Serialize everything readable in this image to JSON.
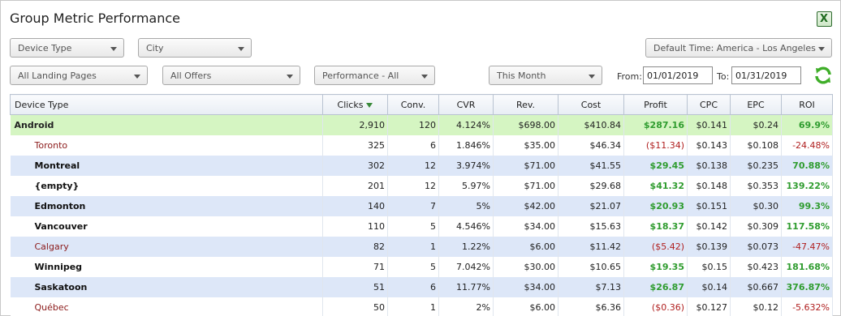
{
  "title": "Group Metric Performance",
  "filters": {
    "device_type": "Device Type",
    "city": "City",
    "time_zone": "Default Time: America - Los Angeles",
    "landing_pages": "All Landing Pages",
    "offers": "All Offers",
    "performance": "Performance - All",
    "date_range": "This Month",
    "from_label": "From:",
    "from_value": "01/01/2019",
    "to_label": "To:",
    "to_value": "01/31/2019"
  },
  "table": {
    "headers": [
      "Device Type",
      "Clicks",
      "Conv.",
      "CVR",
      "Rev.",
      "Cost",
      "Profit",
      "CPC",
      "EPC",
      "ROI"
    ],
    "aggregate": {
      "name": "Android",
      "clicks": "2,910",
      "conv": "120",
      "cvr": "4.124%",
      "rev": "$698.00",
      "cost": "$410.84",
      "profit": "$287.16",
      "cpc": "$0.141",
      "epc": "$0.24",
      "roi": "69.9%"
    },
    "rows": [
      {
        "name": "Toronto",
        "clicks": "325",
        "conv": "6",
        "cvr": "1.846%",
        "rev": "$35.00",
        "cost": "$46.34",
        "profit": "($11.34)",
        "cpc": "$0.143",
        "epc": "$0.108",
        "roi": "-24.48%"
      },
      {
        "name": "Montreal",
        "clicks": "302",
        "conv": "12",
        "cvr": "3.974%",
        "rev": "$71.00",
        "cost": "$41.55",
        "profit": "$29.45",
        "cpc": "$0.138",
        "epc": "$0.235",
        "roi": "70.88%"
      },
      {
        "name": "{empty}",
        "clicks": "201",
        "conv": "12",
        "cvr": "5.97%",
        "rev": "$71.00",
        "cost": "$29.68",
        "profit": "$41.32",
        "cpc": "$0.148",
        "epc": "$0.353",
        "roi": "139.22%"
      },
      {
        "name": "Edmonton",
        "clicks": "140",
        "conv": "7",
        "cvr": "5%",
        "rev": "$42.00",
        "cost": "$21.07",
        "profit": "$20.93",
        "cpc": "$0.151",
        "epc": "$0.30",
        "roi": "99.3%"
      },
      {
        "name": "Vancouver",
        "clicks": "110",
        "conv": "5",
        "cvr": "4.546%",
        "rev": "$34.00",
        "cost": "$15.63",
        "profit": "$18.37",
        "cpc": "$0.142",
        "epc": "$0.309",
        "roi": "117.58%"
      },
      {
        "name": "Calgary",
        "clicks": "82",
        "conv": "1",
        "cvr": "1.22%",
        "rev": "$6.00",
        "cost": "$11.42",
        "profit": "($5.42)",
        "cpc": "$0.139",
        "epc": "$0.073",
        "roi": "-47.47%"
      },
      {
        "name": "Winnipeg",
        "clicks": "71",
        "conv": "5",
        "cvr": "7.042%",
        "rev": "$30.00",
        "cost": "$10.65",
        "profit": "$19.35",
        "cpc": "$0.15",
        "epc": "$0.423",
        "roi": "181.68%"
      },
      {
        "name": "Saskatoon",
        "clicks": "51",
        "conv": "6",
        "cvr": "11.77%",
        "rev": "$34.00",
        "cost": "$7.13",
        "profit": "$26.87",
        "cpc": "$0.14",
        "epc": "$0.667",
        "roi": "376.87%"
      },
      {
        "name": "Québec",
        "clicks": "50",
        "conv": "1",
        "cvr": "2%",
        "rev": "$6.00",
        "cost": "$6.36",
        "profit": "($0.36)",
        "cpc": "$0.127",
        "epc": "$0.12",
        "roi": "-5.632%"
      }
    ]
  },
  "colors": {
    "positive": "#2f9c2f",
    "negative": "#b02020",
    "aggregate_row": "#d5f5c2",
    "alt_row": "#dde7f8"
  }
}
